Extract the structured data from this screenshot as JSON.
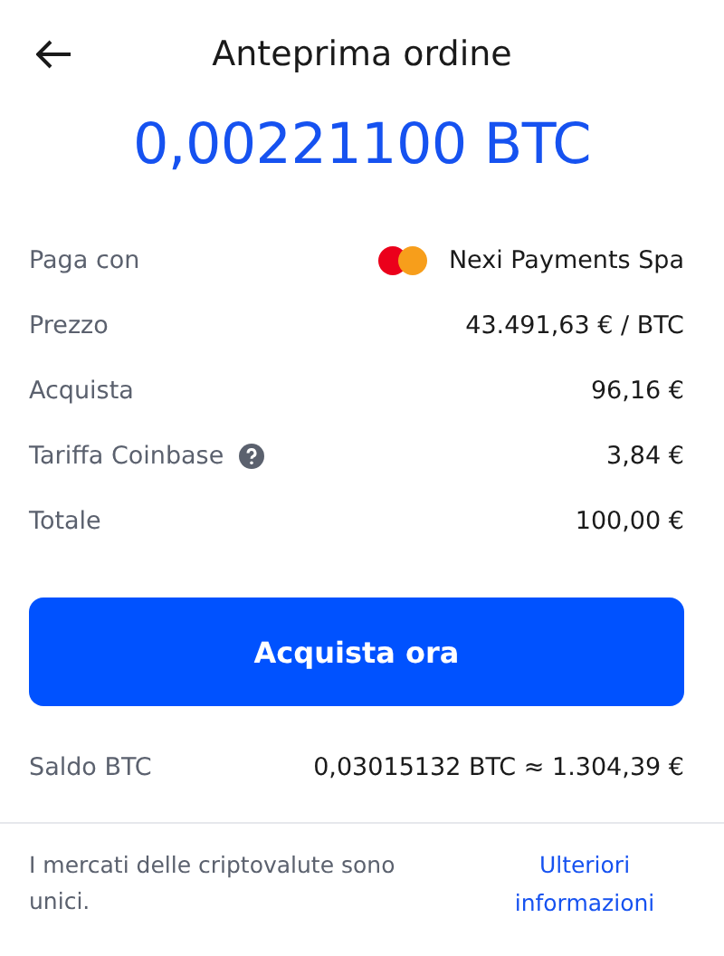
{
  "header": {
    "title": "Anteprima ordine"
  },
  "amount": "0,00221100 BTC",
  "details": [
    {
      "kind": "payment",
      "label": "Paga con",
      "value": "Nexi Payments Spa"
    },
    {
      "kind": "plain",
      "label": "Prezzo",
      "value": "43.491,63 € / BTC"
    },
    {
      "kind": "plain",
      "label": "Acquista",
      "value": "96,16 €"
    },
    {
      "kind": "help",
      "label": "Tariffa Coinbase",
      "value": "3,84 €"
    },
    {
      "kind": "plain",
      "label": "Totale",
      "value": "100,00 €"
    }
  ],
  "button": "Acquista ora",
  "balance": {
    "label": "Saldo BTC",
    "value": "0,03015132 BTC ≈ 1.304,39 €"
  },
  "footer": {
    "text": "I mercati delle criptovalute sono unici.",
    "link": "Ulteriori informazioni"
  }
}
